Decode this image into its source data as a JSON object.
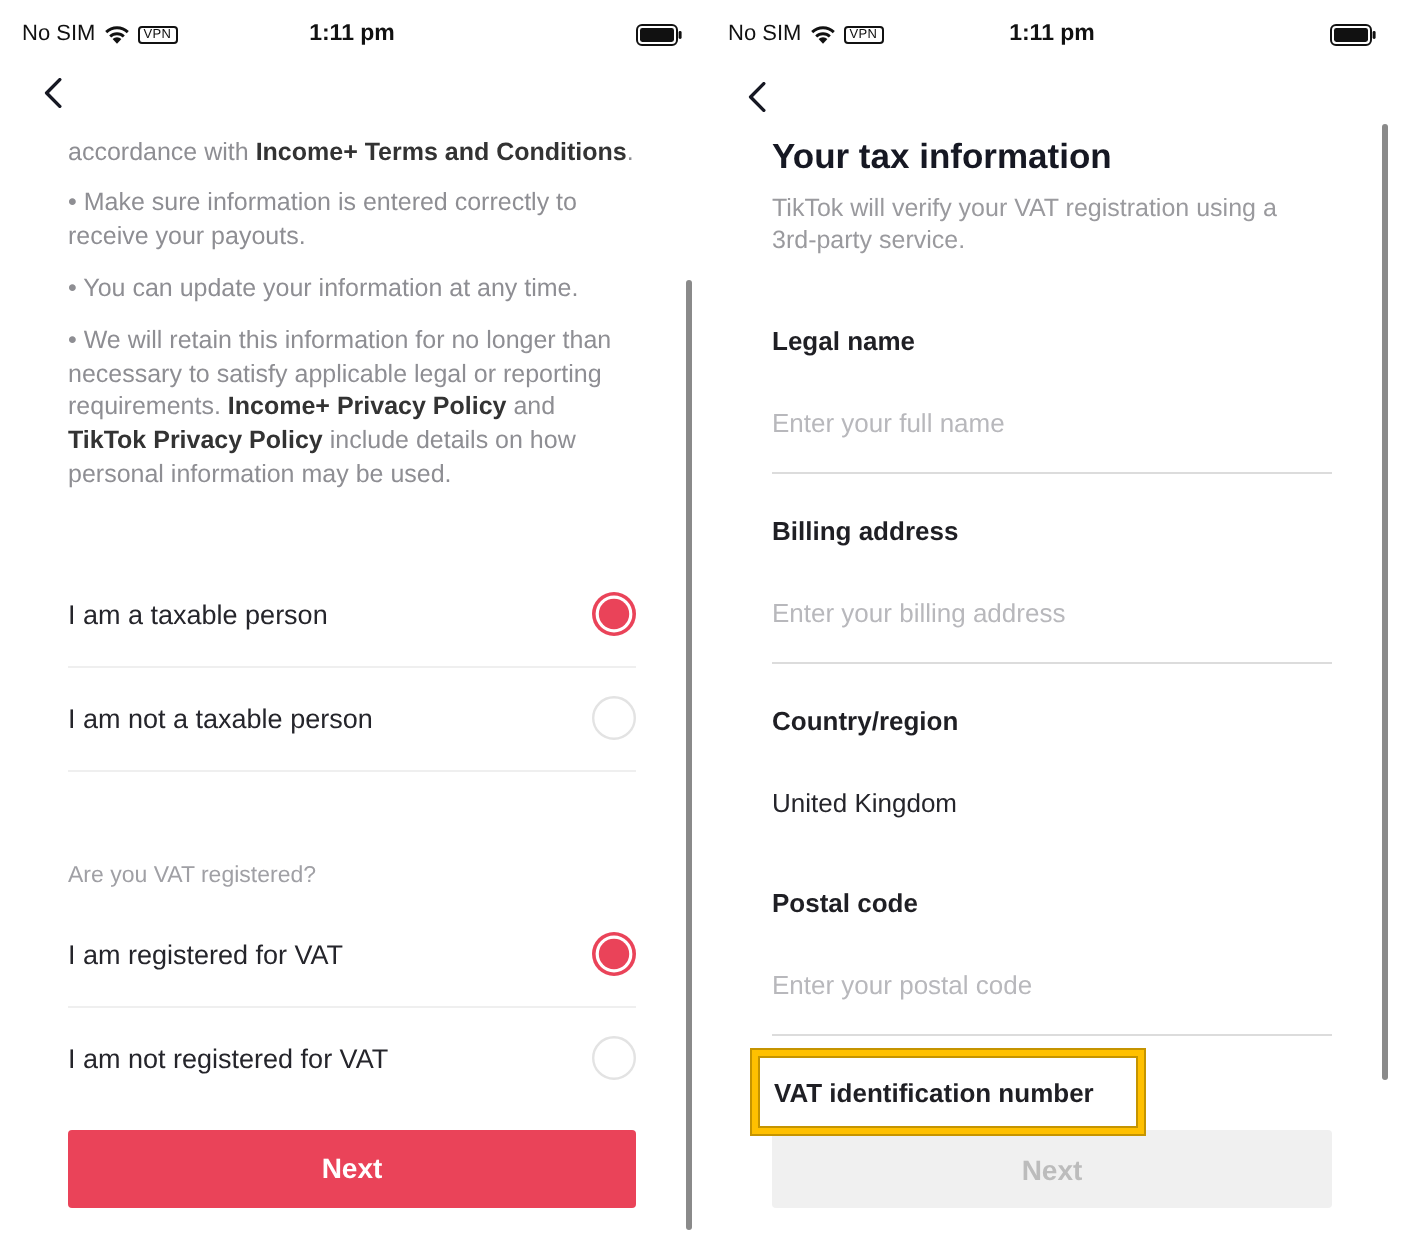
{
  "screens": [
    {
      "kind": "consent",
      "status_bar": {
        "carrier": "No SIM",
        "vpn_badge": "VPN",
        "time": "1:11 pm"
      },
      "notes": [
        "accordance with **Income+ Terms and Conditions**.",
        "• Make sure information is entered correctly to receive your payouts.",
        "• You can update your information at any time.",
        "• We will retain this information for no longer than necessary to satisfy applicable legal or reporting requirements. **Income+ Privacy Policy** and **TikTok Privacy Policy** include details on how personal information may be used."
      ],
      "taxable_options": [
        {
          "label": "I am a taxable person",
          "selected": true
        },
        {
          "label": "I am not a taxable person",
          "selected": false
        }
      ],
      "vat_question": "Are you VAT registered?",
      "vat_options": [
        {
          "label": "I am registered for VAT",
          "selected": true
        },
        {
          "label": "I am not registered for VAT",
          "selected": false
        }
      ],
      "next_button": {
        "label": "Next",
        "disabled": false
      }
    },
    {
      "kind": "form",
      "status_bar": {
        "carrier": "No SIM",
        "vpn_badge": "VPN",
        "time": "1:11 pm"
      },
      "title": "Your tax information",
      "subtitle": "TikTok will verify your VAT registration using a 3rd-party service.",
      "fields": [
        {
          "kind": "text",
          "label": "Legal name",
          "placeholder": "Enter your full name"
        },
        {
          "kind": "text",
          "label": "Billing address",
          "placeholder": "Enter your billing address"
        },
        {
          "kind": "select",
          "label": "Country/region",
          "value": "United Kingdom"
        },
        {
          "kind": "text",
          "label": "Postal code",
          "placeholder": "Enter your postal code"
        },
        {
          "kind": "text",
          "label": "VAT identification number",
          "highlighted": true
        }
      ],
      "next_button": {
        "label": "Next",
        "disabled": true
      }
    }
  ]
}
